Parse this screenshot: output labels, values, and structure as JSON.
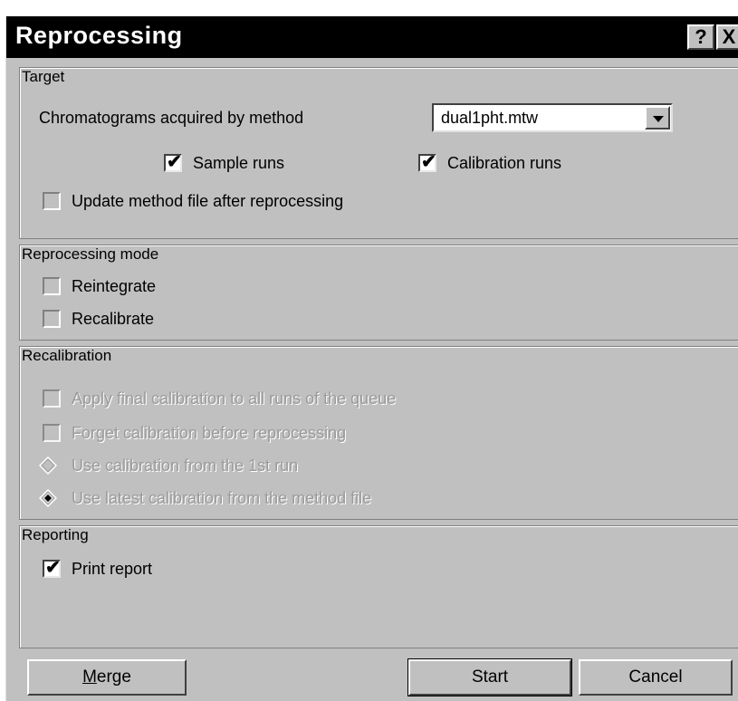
{
  "dialog": {
    "title": "Reprocessing",
    "help_label": "?",
    "close_label": "X"
  },
  "target": {
    "group_label": "Target",
    "method_label": "Chromatograms acquired by method",
    "method_value": "dual1pht.mtw",
    "sample_runs": {
      "label": "Sample runs",
      "checked": true
    },
    "calibration_runs": {
      "label": "Calibration runs",
      "checked": true
    },
    "update_method": {
      "label": "Update method file after reprocessing",
      "checked": false
    }
  },
  "mode": {
    "group_label": "Reprocessing mode",
    "reintegrate": {
      "label": "Reintegrate",
      "checked": false
    },
    "recalibrate": {
      "label": "Recalibrate",
      "checked": false
    }
  },
  "recalibration": {
    "group_label": "Recalibration",
    "apply_final": {
      "label": "Apply final calibration to all runs of the queue",
      "checked": false,
      "enabled": false
    },
    "forget_cal": {
      "label": "Forget calibration before reprocessing",
      "checked": false,
      "enabled": false
    },
    "use_first": {
      "label": "Use calibration from the 1st run",
      "selected": false,
      "enabled": false
    },
    "use_latest": {
      "label": "Use latest calibration from the method file",
      "selected": true,
      "enabled": false
    }
  },
  "reporting": {
    "group_label": "Reporting",
    "print_report": {
      "label": "Print report",
      "checked": true
    }
  },
  "buttons": {
    "merge_first": "M",
    "merge_rest": "erge",
    "start": "Start",
    "cancel": "Cancel"
  },
  "check_glyph": "✔"
}
